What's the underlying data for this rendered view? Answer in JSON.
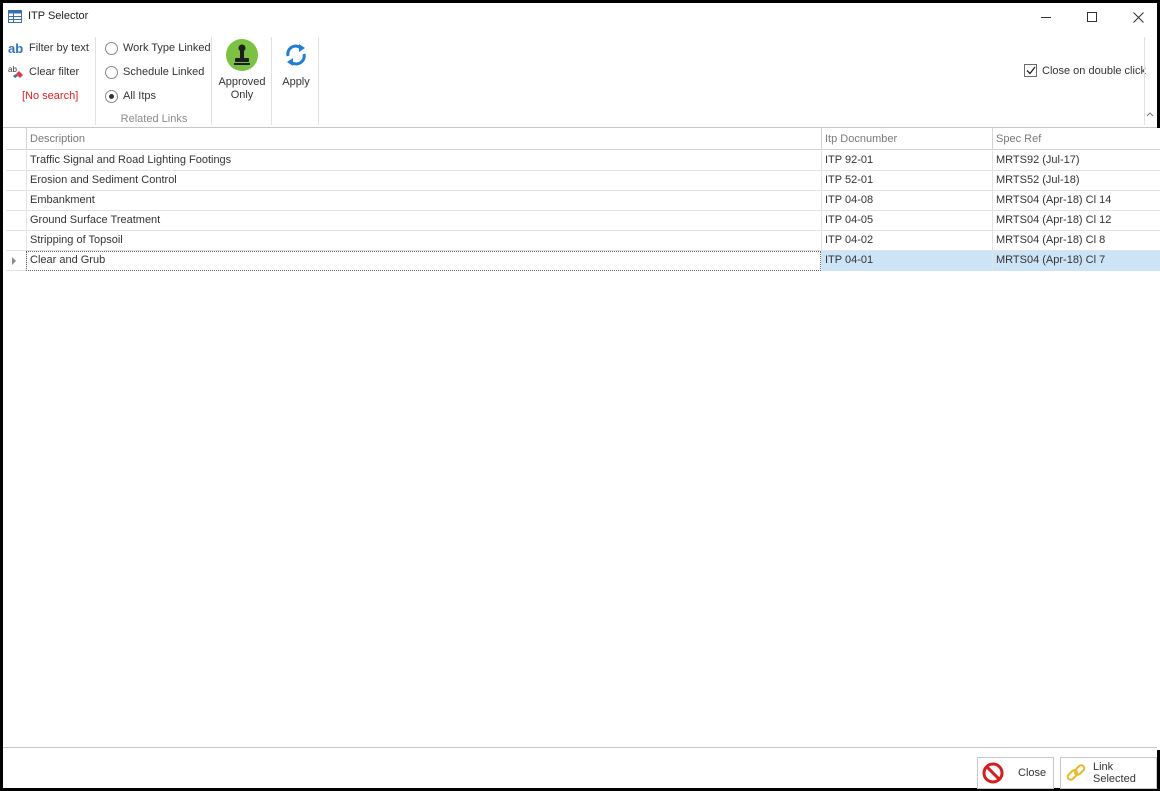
{
  "window": {
    "title": "ITP Selector",
    "icon": "grid-window-icon"
  },
  "ribbon": {
    "filter_by_text": "Filter by text",
    "clear_filter": "Clear filter",
    "filter_icon_text": "ab",
    "search_status": "[No search]",
    "related_links": {
      "caption": "Related Links",
      "options": [
        {
          "label": "Work Type Linked",
          "selected": false
        },
        {
          "label": "Schedule Linked",
          "selected": false
        },
        {
          "label": "All Itps",
          "selected": true
        }
      ]
    },
    "approved_only": {
      "line1": "Approved",
      "line2": "Only"
    },
    "apply": "Apply",
    "close_on_double_click": {
      "label": "Close on double click",
      "checked": true
    }
  },
  "grid": {
    "columns": [
      "Description",
      "Itp Docnumber",
      "Spec Ref"
    ],
    "rows": [
      {
        "description": "Traffic Signal and Road Lighting Footings",
        "itp": "ITP 92-01",
        "spec": "MRTS92 (Jul-17)"
      },
      {
        "description": "Erosion and Sediment Control",
        "itp": "ITP 52-01",
        "spec": "MRTS52 (Jul-18)"
      },
      {
        "description": "Embankment",
        "itp": "ITP 04-08",
        "spec": "MRTS04 (Apr-18) Cl 14"
      },
      {
        "description": "Ground Surface Treatment",
        "itp": "ITP 04-05",
        "spec": "MRTS04 (Apr-18) Cl 12"
      },
      {
        "description": "Stripping of Topsoil",
        "itp": "ITP 04-02",
        "spec": "MRTS04 (Apr-18) Cl 8"
      },
      {
        "description": "Clear and Grub",
        "itp": "ITP 04-01",
        "spec": "MRTS04 (Apr-18) Cl 7"
      }
    ],
    "selected_row": 5
  },
  "footer": {
    "close": "Close",
    "link_selected": "Link Selected"
  },
  "colors": {
    "accent_blue": "#2b73c4",
    "approved_green": "#7cc242",
    "selection": "#cde4f7",
    "no_search_red": "#e21e1e",
    "close_red": "#d91c1c",
    "link_gold": "#e8b923"
  }
}
